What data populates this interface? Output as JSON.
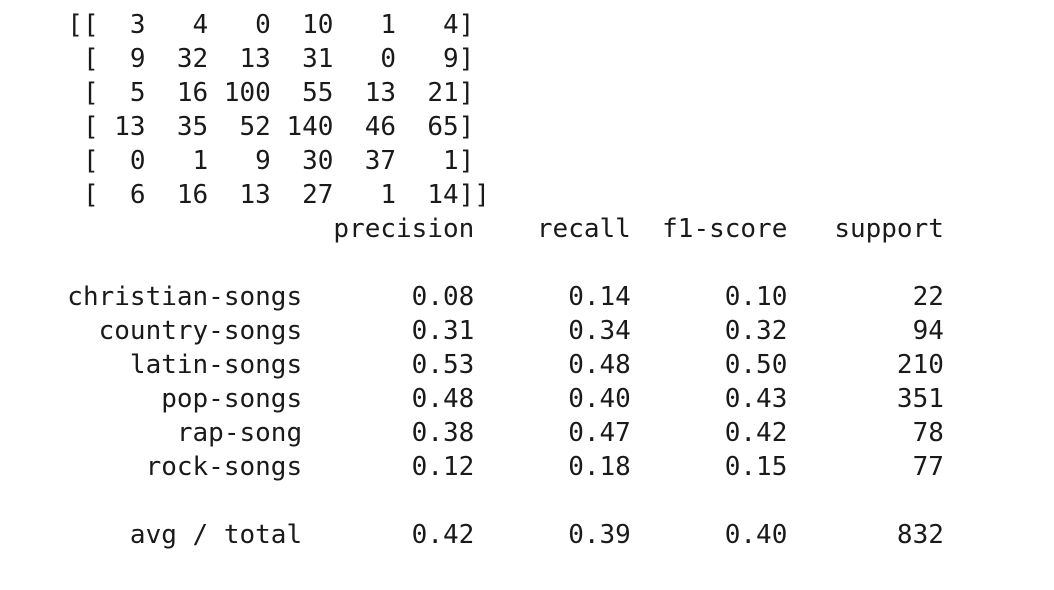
{
  "lines": [
    "  [[  3   4   0  10   1   4]",
    "   [  9  32  13  31   0   9]",
    "   [  5  16 100  55  13  21]",
    "   [ 13  35  52 140  46  65]",
    "   [  0   1   9  30  37   1]",
    "   [  6  16  13  27   1  14]]",
    "                   precision    recall  f1-score   support",
    "",
    "  christian-songs       0.08      0.14      0.10        22",
    "    country-songs       0.31      0.34      0.32        94",
    "      latin-songs       0.53      0.48      0.50       210",
    "        pop-songs       0.48      0.40      0.43       351",
    "         rap-song       0.38      0.47      0.42        78",
    "       rock-songs       0.12      0.18      0.15        77",
    "",
    "      avg / total       0.42      0.39      0.40       832"
  ],
  "confusion_matrix": [
    [
      3,
      4,
      0,
      10,
      1,
      4
    ],
    [
      9,
      32,
      13,
      31,
      0,
      9
    ],
    [
      5,
      16,
      100,
      55,
      13,
      21
    ],
    [
      13,
      35,
      52,
      140,
      46,
      65
    ],
    [
      0,
      1,
      9,
      30,
      37,
      1
    ],
    [
      6,
      16,
      13,
      27,
      1,
      14
    ]
  ],
  "report": {
    "columns": [
      "precision",
      "recall",
      "f1-score",
      "support"
    ],
    "rows": [
      {
        "label": "christian-songs",
        "precision": 0.08,
        "recall": 0.14,
        "f1_score": 0.1,
        "support": 22
      },
      {
        "label": "country-songs",
        "precision": 0.31,
        "recall": 0.34,
        "f1_score": 0.32,
        "support": 94
      },
      {
        "label": "latin-songs",
        "precision": 0.53,
        "recall": 0.48,
        "f1_score": 0.5,
        "support": 210
      },
      {
        "label": "pop-songs",
        "precision": 0.48,
        "recall": 0.4,
        "f1_score": 0.43,
        "support": 351
      },
      {
        "label": "rap-song",
        "precision": 0.38,
        "recall": 0.47,
        "f1_score": 0.42,
        "support": 78
      },
      {
        "label": "rock-songs",
        "precision": 0.12,
        "recall": 0.18,
        "f1_score": 0.15,
        "support": 77
      }
    ],
    "total": {
      "label": "avg / total",
      "precision": 0.42,
      "recall": 0.39,
      "f1_score": 0.4,
      "support": 832
    }
  },
  "colors": {
    "text": "#1a1a1a",
    "background": "#ffffff"
  }
}
